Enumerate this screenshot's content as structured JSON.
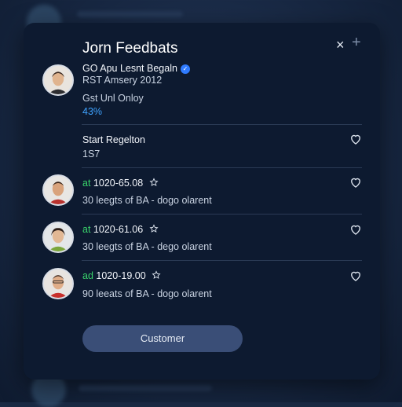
{
  "dialog": {
    "title": "Jorn Feedbats",
    "close_label": "×",
    "add_label": "+"
  },
  "profile": {
    "name": "GO Apu Lesnt Begaln",
    "date": "RST Amsery 2012",
    "status": "Gst Unl Onloy",
    "percent": "43%"
  },
  "section": {
    "title": "Start Regelton",
    "count": "1S7"
  },
  "reviews": [
    {
      "tag": "at",
      "time": "1020-65.08",
      "text": "30 leegts of BA - dogo olarent"
    },
    {
      "tag": "at",
      "time": "1020-61.06",
      "text": "30 leegts of BA - dego olarent"
    },
    {
      "tag": "ad",
      "time": "1020-19.00",
      "text": "90 leeats of BA - dogo olarent"
    }
  ],
  "footer": {
    "button_label": "Customer"
  },
  "colors": {
    "accent": "#3fa3ff",
    "green": "#39d26b",
    "button": "#3a4e77",
    "panel": "#0d1a30"
  }
}
